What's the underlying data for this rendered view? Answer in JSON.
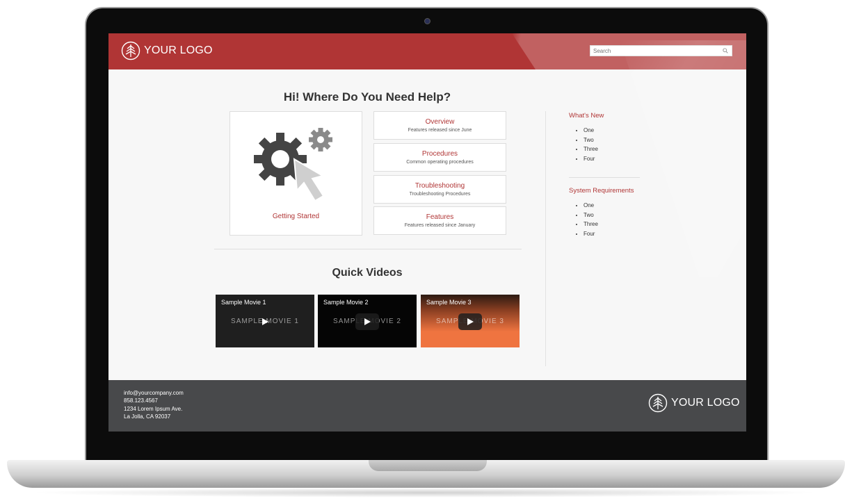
{
  "header": {
    "logo_text": "YOUR LOGO",
    "search_placeholder": "Search"
  },
  "main": {
    "title": "Hi! Where Do You Need Help?",
    "getting_started_label": "Getting Started",
    "cards": [
      {
        "title": "Overview",
        "subtitle": "Features released since June"
      },
      {
        "title": "Procedures",
        "subtitle": "Common operating procedures"
      },
      {
        "title": "Troubleshooting",
        "subtitle": "Troubleshooting Procedures"
      },
      {
        "title": "Features",
        "subtitle": "Features released since January"
      }
    ],
    "videos_title": "Quick Videos",
    "videos": [
      {
        "name": "Sample Movie 1",
        "watermark": "SAMPLE MOVIE 1"
      },
      {
        "name": "Sample Movie 2",
        "watermark": "SAMPLE MOVIE 2"
      },
      {
        "name": "Sample Movie 3",
        "watermark": "SAMPLE MOVIE 3"
      }
    ]
  },
  "sidebar": {
    "whats_new": {
      "title": "What's New",
      "items": [
        "One",
        "Two",
        "Three",
        "Four"
      ]
    },
    "system_requirements": {
      "title": "System Requirements",
      "items": [
        "One",
        "Two",
        "Three",
        "Four"
      ]
    }
  },
  "footer": {
    "email": "info@yourcompany.com",
    "phone": "858.123.4567",
    "address1": "1234 Lorem Ipsum Ave.",
    "address2": "La Jolla, CA 92037",
    "logo_text": "YOUR LOGO"
  },
  "colors": {
    "brand_red": "#b03535",
    "footer_gray": "#48494b",
    "video_3_orange": "#ef7440"
  }
}
